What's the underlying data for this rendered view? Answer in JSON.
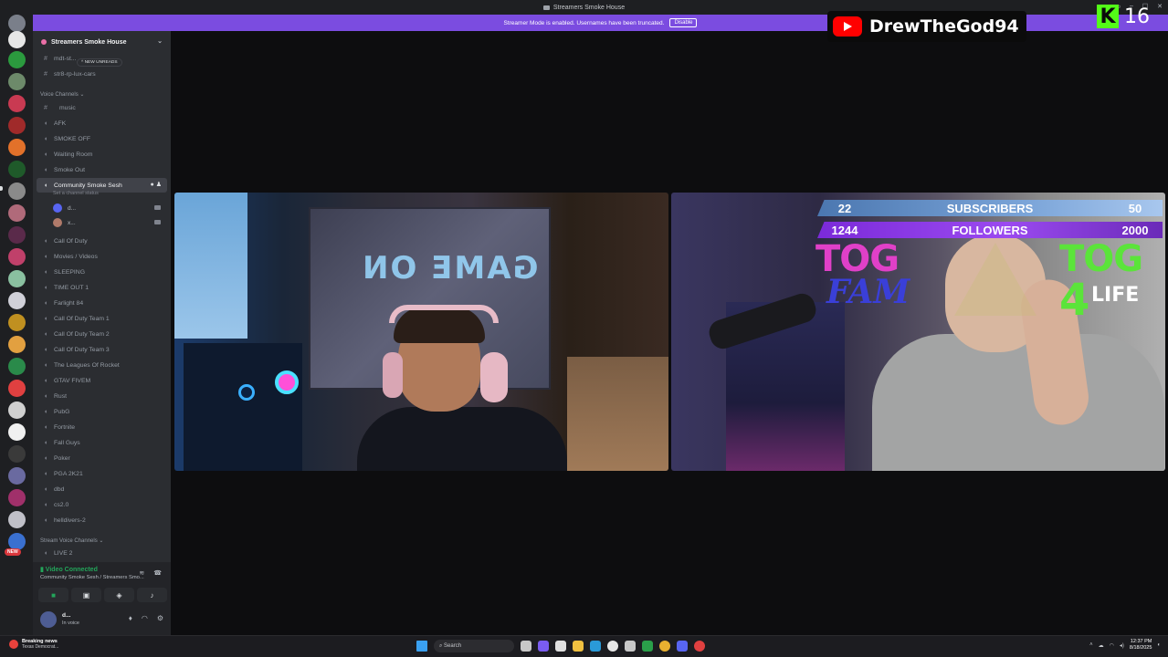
{
  "window": {
    "title": "Streamers Smoke House"
  },
  "banner": {
    "text": "Streamer Mode is enabled. Usernames have been truncated.",
    "button": "Disable"
  },
  "server": {
    "name": "Streamers Smoke House"
  },
  "channels": {
    "text": [
      {
        "name": "mdt-st..."
      },
      {
        "name": "str8-rp-lux-cars"
      }
    ],
    "unread_pill": "^ NEW UNREADS",
    "voice_category": "Voice Channels",
    "music": "music",
    "voice": [
      "AFK",
      "SMOKE OFF",
      "Waiting Room",
      "Smoke Out"
    ],
    "active": "Community Smoke Sesh",
    "set_status": "Set a channel status",
    "voice_users": [
      "d...",
      "x..."
    ],
    "voice_more": [
      "Call Of Duty",
      "Movies / Videos",
      "SLEEPING",
      "TIME OUT 1",
      "Farlight 84",
      "Call Of Duty Team 1",
      "Call Of Duty Team 2",
      "Call Of Duty Team 3",
      "The Leagues Of Rocket",
      "GTAV FIVEM",
      "Rust",
      "PubG",
      "Fortnite",
      "Fall Guys",
      "Poker",
      "PGA 2K21",
      "dbd",
      "cs2.0",
      "helldivers-2"
    ],
    "stream_category": "Stream Voice Channels",
    "stream_first": "LIVE 2"
  },
  "voice_panel": {
    "status": "Video Connected",
    "location": "Community Smoke Sesh / Streamers Smo..."
  },
  "user_panel": {
    "name": "d...",
    "status": "In voice"
  },
  "rail": {
    "new_badge": "NEW"
  },
  "overlay": {
    "subs_current": "22",
    "subs_label": "SUBSCRIBERS",
    "subs_goal": "50",
    "followers_current": "1244",
    "followers_label": "FOLLOWERS",
    "followers_goal": "2000",
    "tog_left_1": "TOG",
    "tog_left_2": "FAM",
    "tog_right_1": "TOG",
    "tog_right_2": "4",
    "tog_right_3": "LIFE",
    "left_graffiti": "GAME ON"
  },
  "youtube": {
    "channel": "DrewTheGod94"
  },
  "kick": {
    "letter": "K",
    "count": "16"
  },
  "taskbar": {
    "news_title": "Breaking news",
    "news_sub": "Texas Democrat...",
    "search": "Search",
    "time": "12:37 PM",
    "date": "8/18/2025"
  }
}
